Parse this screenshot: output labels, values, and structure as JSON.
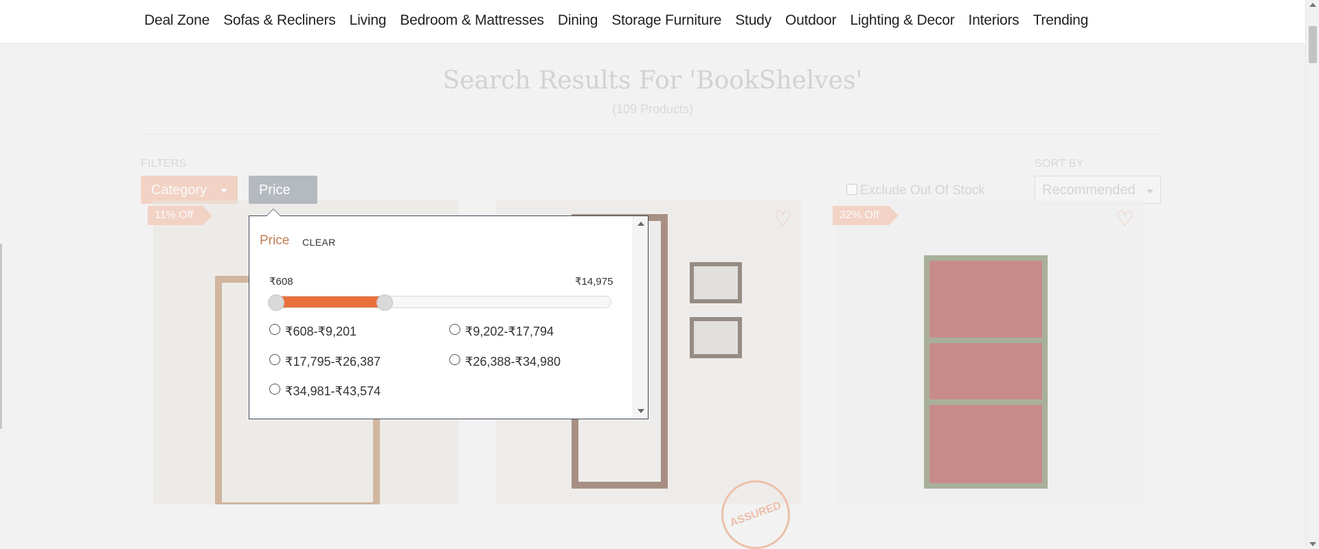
{
  "nav": {
    "items": [
      "Deal Zone",
      "Sofas & Recliners",
      "Living",
      "Bedroom & Mattresses",
      "Dining",
      "Storage Furniture",
      "Study",
      "Outdoor",
      "Lighting & Decor",
      "Interiors",
      "Trending"
    ]
  },
  "search": {
    "title": "Search Results For 'BookShelves'",
    "count": "(109 Products)"
  },
  "filters": {
    "label": "FILTERS",
    "category_label": "Category",
    "price_label": "Price",
    "exclude_label": "Exclude Out Of Stock",
    "exclude_checked": false
  },
  "sort": {
    "label": "SORT BY",
    "selected": "Recommended"
  },
  "price_panel": {
    "title": "Price",
    "clear_label": "CLEAR",
    "range_min": "₹608",
    "range_max": "₹14,975",
    "slider_low_fraction": 0.0,
    "slider_high_fraction": 0.33,
    "options": [
      "₹608-₹9,201",
      "₹9,202-₹17,794",
      "₹17,795-₹26,387",
      "₹26,388-₹34,980",
      "₹34,981-₹43,574"
    ]
  },
  "products": [
    {
      "badge": "11% Off",
      "wishlist_icon": "heart-outline-icon"
    },
    {
      "badge": "",
      "wishlist_icon": "heart-outline-icon",
      "seal": "ASSURED"
    },
    {
      "badge": "32% Off",
      "wishlist_icon": "heart-outline-icon"
    }
  ],
  "colors": {
    "accent": "#e8703a",
    "price_title": "#c57d55",
    "badge": "#f4b9a2",
    "category_button": "#f2b9a0"
  }
}
